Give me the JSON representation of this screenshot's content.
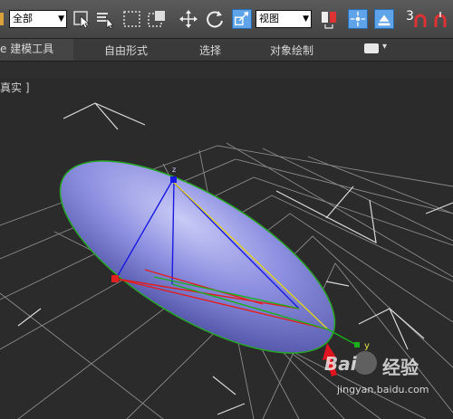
{
  "toolbar": {
    "selection_filter": "全部",
    "reference_coord": "视图",
    "snap_count": "3",
    "icons": [
      "select-object-icon",
      "select-by-name-icon",
      "rect-selection-icon",
      "window-crossing-icon",
      "move-icon",
      "rotate-icon",
      "scale-icon",
      "mirror-icon",
      "use-pivot-center-icon",
      "align-icon",
      "snaps-toggle-icon",
      "magnet-icon"
    ]
  },
  "ribbon": {
    "tabs": [
      {
        "label": "e 建模工具",
        "active": true
      },
      {
        "label": "自由形式",
        "active": false
      },
      {
        "label": "选择",
        "active": false
      },
      {
        "label": "对象绘制",
        "active": false
      }
    ],
    "extra_label": "▾"
  },
  "viewport": {
    "label": "真实 ]",
    "axis_y": "y",
    "axis_z": "z"
  },
  "watermark": {
    "brand": "Bai",
    "brand2": "经验",
    "url": "jingyan.baidu.com"
  },
  "colors": {
    "ellipsoid": "#8d8fe0",
    "grid": "#8a8a8a",
    "x_axis": "#e02020",
    "y_axis": "#1ab01a",
    "z_axis": "#1a1ae0",
    "accent": "#5fa3e8"
  }
}
